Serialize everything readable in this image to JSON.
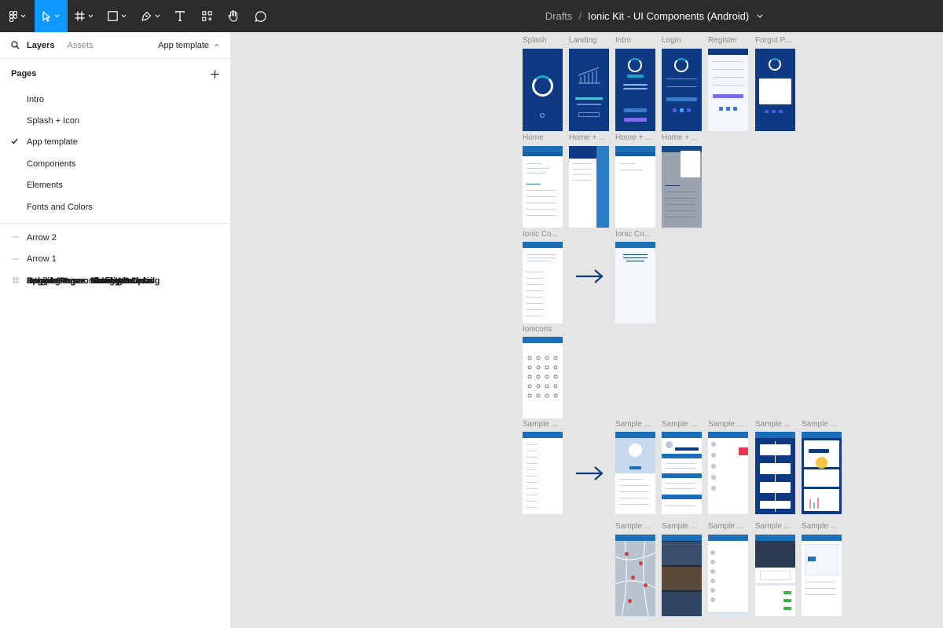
{
  "toolbar": {
    "main_menu_icon": "figma-logo-icon",
    "tools": [
      "move-tool",
      "frame-tool",
      "shape-tool",
      "pen-tool",
      "text-tool",
      "resources-tool",
      "hand-tool",
      "comment-tool"
    ],
    "accent": "#0d99ff",
    "background": "#2c2c2c"
  },
  "breadcrumb": {
    "folder": "Drafts",
    "separator": "/",
    "file": "Ionic Kit - UI Components (Android)"
  },
  "panel": {
    "tabs": {
      "layers": "Layers",
      "assets": "Assets"
    },
    "current_page": "App template",
    "pages_header": "Pages",
    "pages": [
      "Intro",
      "Splash + Icon",
      "App template",
      "Components",
      "Elements",
      "Fonts and Colors"
    ],
    "selected_page": "App template",
    "layers": [
      {
        "name": "Arrow 2",
        "kind": "line"
      },
      {
        "name": "Arrow 1",
        "kind": "line"
      },
      {
        "name": "Sample Pages: Categories",
        "kind": "frame"
      },
      {
        "name": "Sample Pages: Nearby",
        "kind": "frame"
      },
      {
        "name": "Sample Pages: Charts+Graphs",
        "kind": "frame"
      },
      {
        "name": "Sample Pages: Timeline",
        "kind": "frame"
      },
      {
        "name": "Sample Pages: Business Detail",
        "kind": "frame"
      },
      {
        "name": "Sample Pages: Business Listing",
        "kind": "frame"
      },
      {
        "name": "Sample Pages: Messages",
        "kind": "frame"
      },
      {
        "name": "Sample Pages: Settings",
        "kind": "frame"
      },
      {
        "name": "Sample Pages: Local Weather",
        "kind": "frame"
      },
      {
        "name": "Sample Pages: Profile",
        "kind": "frame"
      },
      {
        "name": "Splash",
        "kind": "frame"
      },
      {
        "name": "Register",
        "kind": "frame"
      },
      {
        "name": "Forgot Password",
        "kind": "frame"
      },
      {
        "name": "Login",
        "kind": "frame"
      },
      {
        "name": "Intro",
        "kind": "frame"
      },
      {
        "name": "Landing",
        "kind": "frame"
      },
      {
        "name": "Home + Menu",
        "kind": "frame"
      }
    ]
  },
  "canvas": {
    "row1_labels": [
      "Splash",
      "Landing",
      "Intro",
      "Login",
      "Register",
      "Forgot P..."
    ],
    "row2_labels": [
      "Home",
      "Home + ...",
      "Home + ...",
      "Home + ..."
    ],
    "row3_labels": [
      "Ionic Co...",
      "Ionic Co..."
    ],
    "row4_labels": [
      "Ionicons"
    ],
    "row5_labels": [
      "Sample ...",
      "Sample ...",
      "Sample ...",
      "Sample ...",
      "Sample ...",
      "Sample ..."
    ],
    "row6_labels": [
      "Sample ...",
      "Sample ...",
      "Sample ...",
      "Sample ...",
      "Sample ..."
    ],
    "colors": {
      "dark_frame": "#0d3a82",
      "accent_blue": "#1a6fb8",
      "arrow": "#0d3a82"
    }
  }
}
